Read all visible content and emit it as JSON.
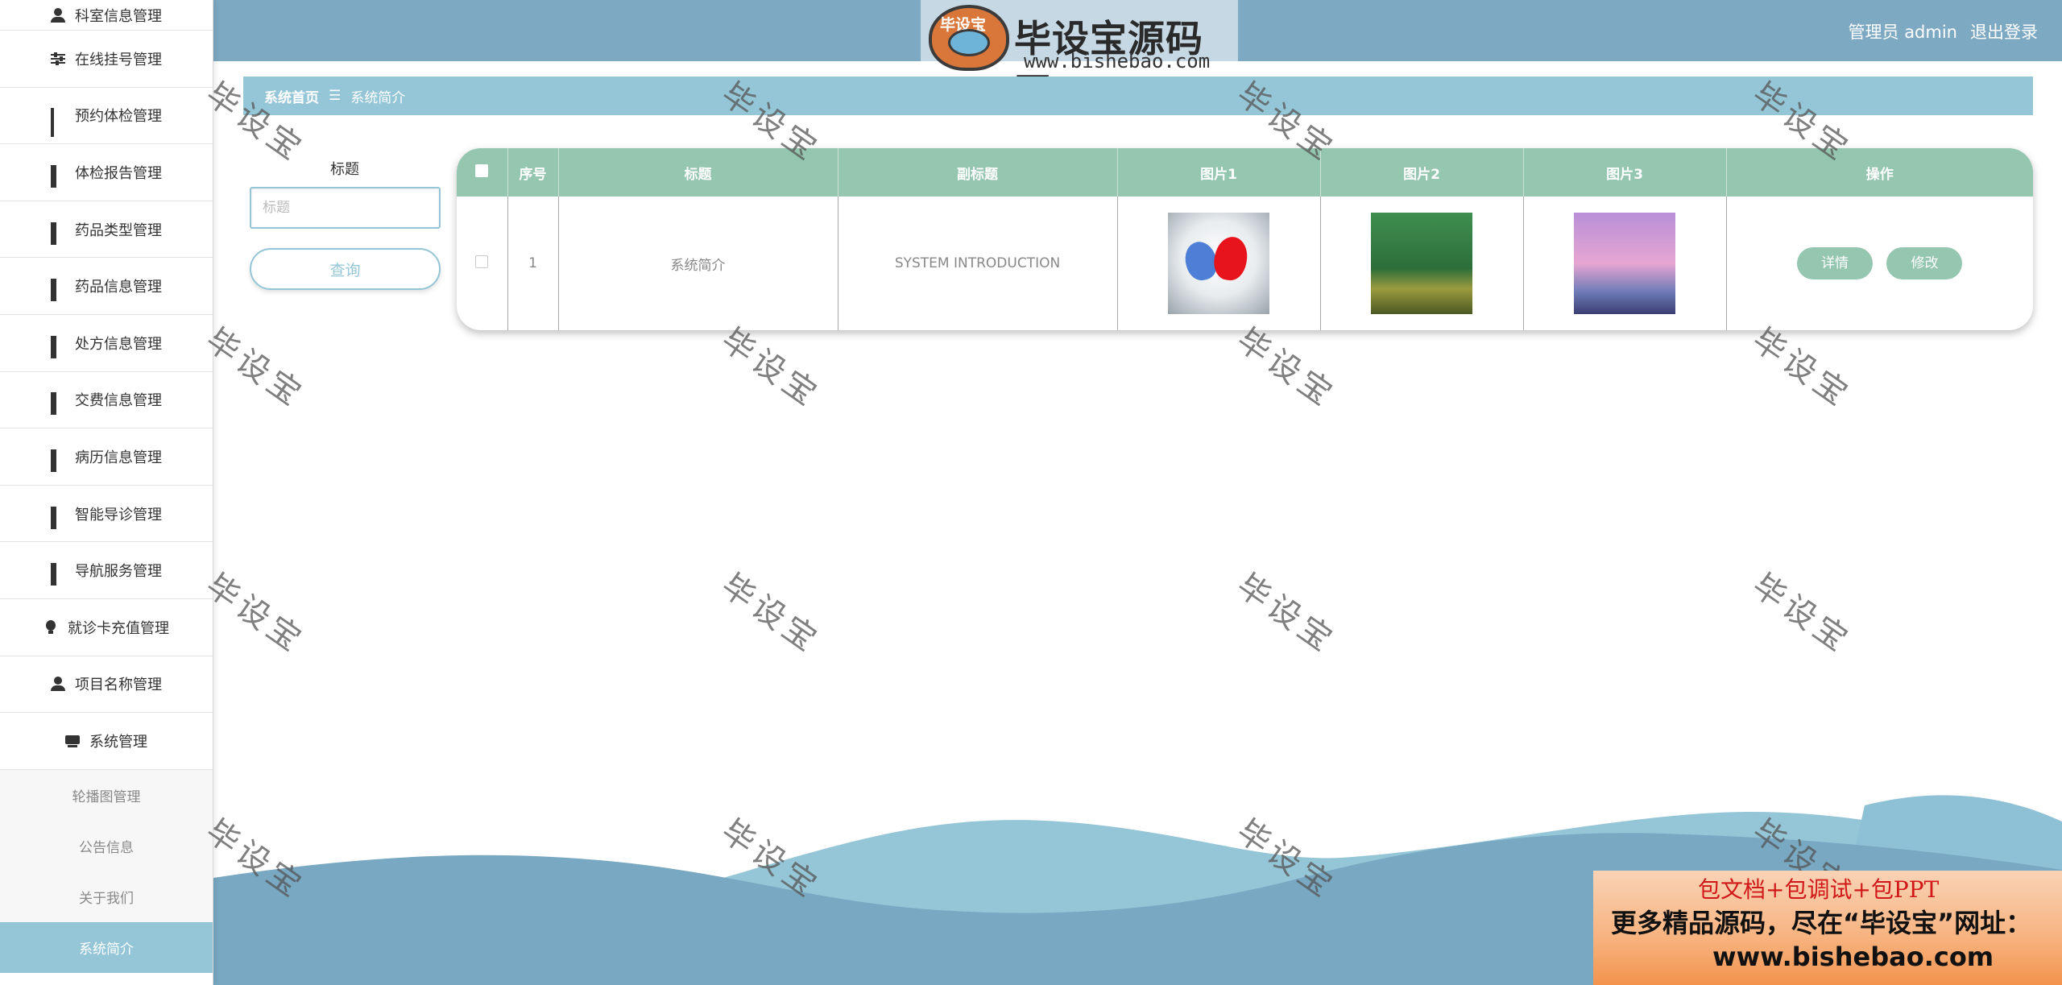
{
  "header": {
    "user_label": "管理员 admin",
    "logout_label": "退出登录"
  },
  "logo": {
    "badge_text": "毕设宝",
    "brand_text": "毕设宝源码网",
    "url_text": "www.bishebao.com"
  },
  "sidebar": {
    "items": [
      {
        "label": "科室信息管理",
        "icon": "user-icon"
      },
      {
        "label": "在线挂号管理",
        "icon": "sliders-icon"
      },
      {
        "label": "预约体检管理",
        "icon": "grid-dots-icon"
      },
      {
        "label": "体检报告管理",
        "icon": "grid-icon"
      },
      {
        "label": "药品类型管理",
        "icon": "grid-icon"
      },
      {
        "label": "药品信息管理",
        "icon": "grid-icon"
      },
      {
        "label": "处方信息管理",
        "icon": "grid-icon"
      },
      {
        "label": "交费信息管理",
        "icon": "grid-icon"
      },
      {
        "label": "病历信息管理",
        "icon": "grid-icon"
      },
      {
        "label": "智能导诊管理",
        "icon": "grid-icon"
      },
      {
        "label": "导航服务管理",
        "icon": "grid-icon"
      },
      {
        "label": "就诊卡充值管理",
        "icon": "bulb-icon"
      },
      {
        "label": "项目名称管理",
        "icon": "user-icon"
      },
      {
        "label": "系统管理",
        "icon": "box-icon"
      }
    ],
    "subitems": [
      {
        "label": "轮播图管理"
      },
      {
        "label": "公告信息"
      },
      {
        "label": "关于我们"
      },
      {
        "label": "系统简介"
      }
    ]
  },
  "breadcrumb": {
    "home": "系统首页",
    "separator": "☰",
    "current": "系统简介"
  },
  "search": {
    "label": "标题",
    "placeholder": "标题",
    "button": "查询"
  },
  "table": {
    "headers": [
      "序号",
      "标题",
      "副标题",
      "图片1",
      "图片2",
      "图片3",
      "操作"
    ],
    "rows": [
      {
        "index": "1",
        "title": "系统简介",
        "subtitle": "SYSTEM INTRODUCTION"
      }
    ],
    "detail_label": "详情",
    "edit_label": "修改"
  },
  "watermark": "毕设宝",
  "promo": {
    "line1": "包文档+包调试+包PPT",
    "line2": "更多精品源码，尽在“毕设宝”网址：",
    "line3": "www.bishebao.com"
  },
  "colors": {
    "header": "#7ea9c3",
    "accent": "#95c6d7",
    "table_header": "#95c6b0"
  }
}
